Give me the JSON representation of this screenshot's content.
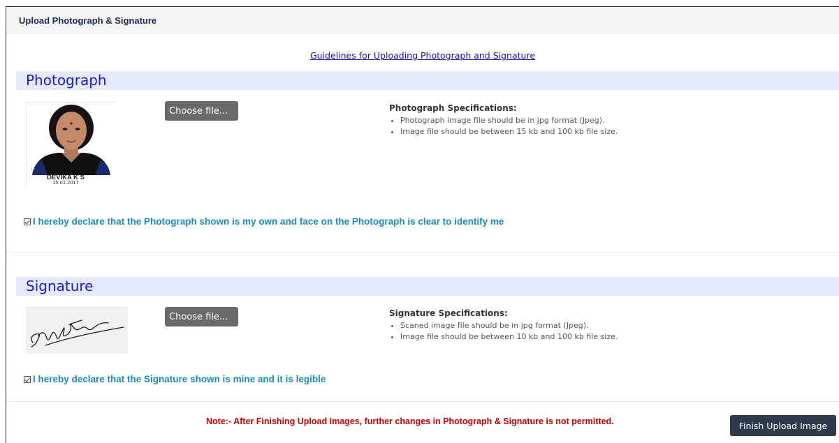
{
  "panel": {
    "title": "Upload Photograph & Signature"
  },
  "guidelines": {
    "link_text": "Guidelines for Uploading Photograph and Signature"
  },
  "photograph": {
    "section_title": "Photograph",
    "choose_label": "Choose file...",
    "caption_name": "DEVIKA K S",
    "caption_date": "15.01.2017",
    "specs_title": "Photograph Specifications:",
    "specs": [
      "Photograph image file should be in jpg format (Jpeg).",
      "Image file should be between 15 kb and 100 kb file size."
    ],
    "declaration": "I hereby declare that the Photograph shown is my own and face on the Photograph is clear to identify me"
  },
  "signature": {
    "section_title": "Signature",
    "choose_label": "Choose file...",
    "specs_title": "Signature Specifications:",
    "specs": [
      "Scaned image file should be in jpg format (Jpeg).",
      "Image file should be between 10 kb and 100 kb file size."
    ],
    "declaration": "I hereby declare that the Signature shown is mine and it is legible"
  },
  "footer": {
    "note": "Note:- After Finishing Upload Images, further changes in Photograph & Signature is not permitted.",
    "finish_label": "Finish Upload Image"
  },
  "colors": {
    "section_bar": "#e4eafb",
    "section_title": "#1b1bd3",
    "declaration": "#1d8ab9",
    "note": "#cc0000",
    "finish_button": "#2f3b4b"
  }
}
